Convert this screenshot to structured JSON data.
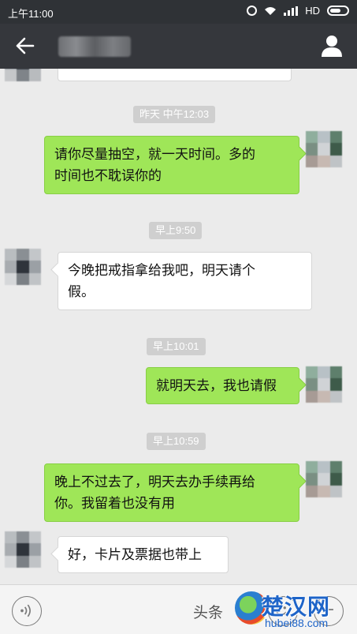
{
  "status_bar": {
    "time": "上午11:00",
    "network": "HD"
  },
  "header": {
    "back_icon": "back-arrow-icon",
    "contact_name": "",
    "profile_icon": "person-icon"
  },
  "messages": [
    {
      "type": "timestamp",
      "text": "昨天 中午12:03"
    },
    {
      "type": "outgoing",
      "line1": "请你尽量抽空，就一天时间。多的",
      "line2": "时间也不耽误你的"
    },
    {
      "type": "timestamp",
      "text": "早上9:50"
    },
    {
      "type": "incoming",
      "line1": "今晚把戒指拿给我吧，明天请个",
      "line2": "假。"
    },
    {
      "type": "timestamp",
      "text": "早上10:01"
    },
    {
      "type": "outgoing",
      "line1": "就明天去，我也请假"
    },
    {
      "type": "timestamp",
      "text": "早上10:59"
    },
    {
      "type": "outgoing",
      "line1": "晚上不过去了，明天去办手续再给",
      "line2": "你。我留着也没有用"
    },
    {
      "type": "incoming",
      "line1": "好，卡片及票据也带上"
    }
  ],
  "footer": {
    "voice_icon": "voice-icon",
    "emoji_icon": "emoji-icon",
    "plus_icon": "plus-icon"
  },
  "watermark": {
    "text": "头条",
    "logo_text": "楚汉网",
    "url": "hubei88.com"
  },
  "colors": {
    "outgoing_bubble": "#9fe658",
    "incoming_bubble": "#ffffff",
    "header": "#35373c",
    "background": "#ebebeb"
  }
}
